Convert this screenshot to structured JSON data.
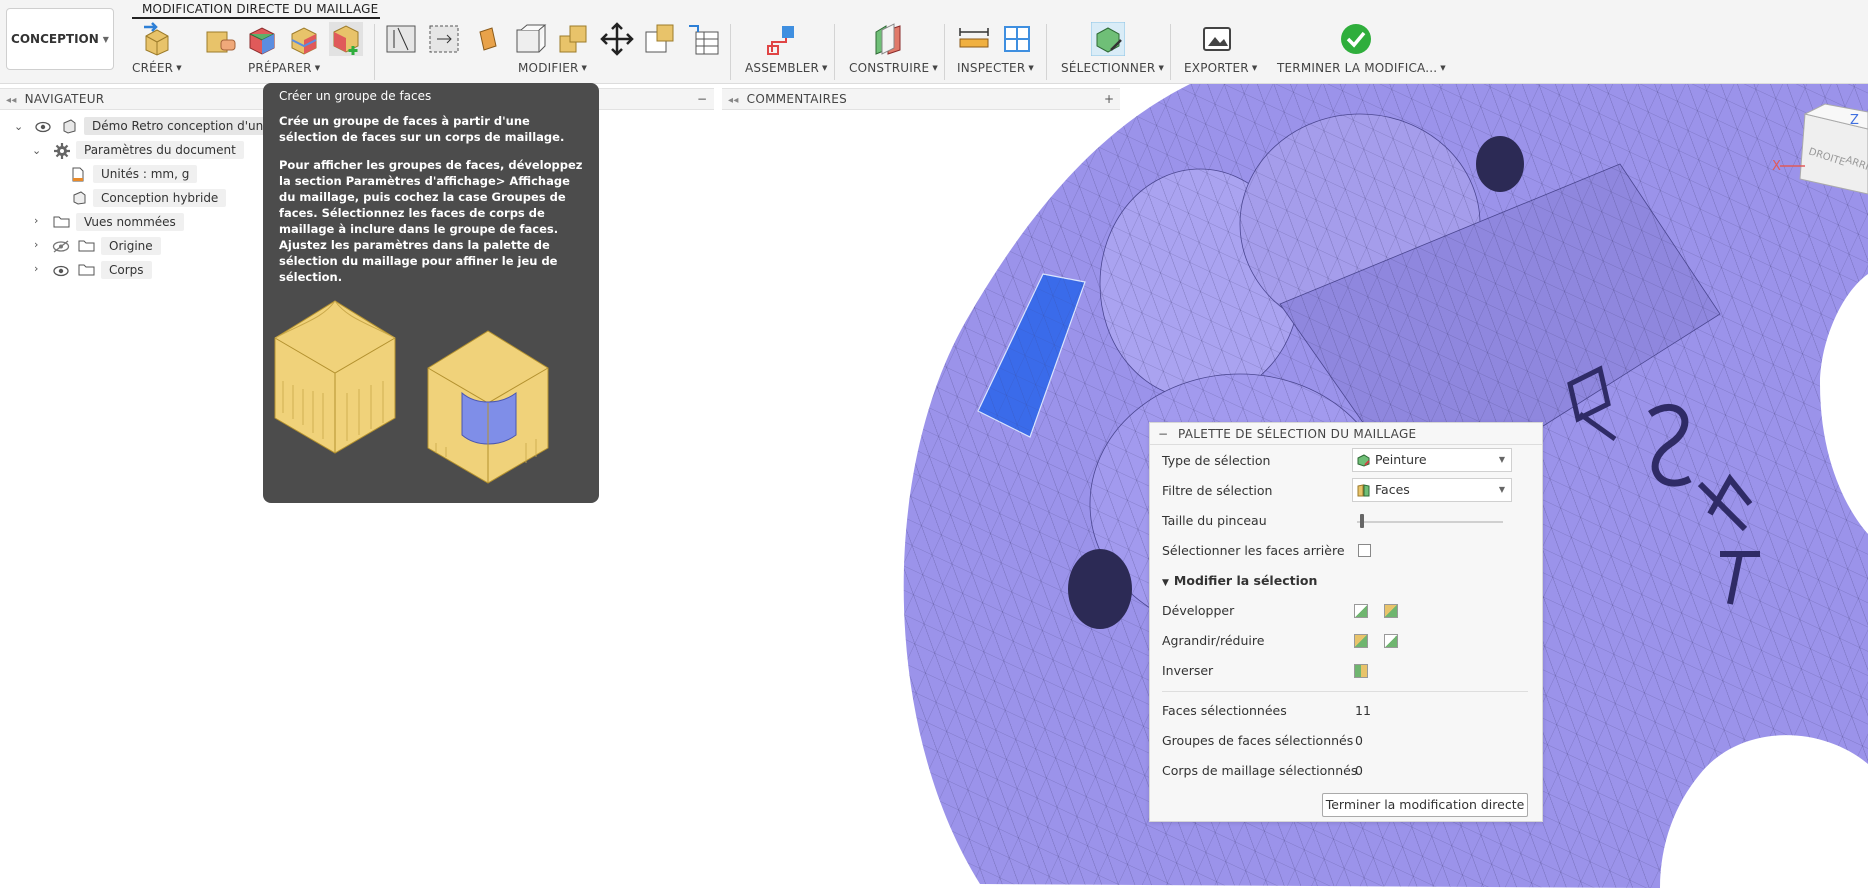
{
  "toolbar": {
    "workspace": "CONCEPTION",
    "active_tab": "MODIFICATION DIRECTE DU MAILLAGE",
    "groups": {
      "create": "CRÉER",
      "prepare": "PRÉPARER",
      "modify": "MODIFIER",
      "assemble": "ASSEMBLER",
      "construct": "CONSTRUIRE",
      "inspect": "INSPECTER",
      "select": "SÉLECTIONNER",
      "export": "EXPORTER",
      "finish": "TERMINER LA MODIFICA..."
    }
  },
  "navigator": {
    "title": "NAVIGATEUR",
    "root": "Démo Retro conception d'un S",
    "items": {
      "doc_params": "Paramètres du document",
      "units": "Unités : mm, g",
      "hybrid": "Conception hybride",
      "named_views": "Vues nommées",
      "origin": "Origine",
      "bodies": "Corps"
    }
  },
  "comments": {
    "title": "COMMENTAIRES"
  },
  "tooltip": {
    "title": "Créer un groupe de faces",
    "paragraph1": "Crée un groupe de faces à partir d'une sélection de faces sur un corps de maillage.",
    "paragraph2": "Pour afficher les groupes de faces, développez la section Paramètres d'affichage> Affichage du maillage, puis cochez la case Groupes de faces. Sélectionnez les faces de corps de maillage à inclure dans le groupe de faces. Ajustez les paramètres dans la palette de sélection du maillage pour affiner le jeu de sélection."
  },
  "palette": {
    "title": "PALETTE DE SÉLECTION DU MAILLAGE",
    "selection_type_label": "Type de sélection",
    "selection_type_value": "Peinture",
    "selection_filter_label": "Filtre de sélection",
    "selection_filter_value": "Faces",
    "brush_size_label": "Taille du pinceau",
    "brush_size": 0.02,
    "back_faces_label": "Sélectionner les faces arrière",
    "back_faces_checked": false,
    "modify_section": "Modifier la sélection",
    "develop_label": "Développer",
    "grow_shrink_label": "Agrandir/réduire",
    "invert_label": "Inverser",
    "faces_selected_label": "Faces sélectionnées",
    "faces_selected": "11",
    "face_groups_label": "Groupes de faces sélectionnés",
    "face_groups": "0",
    "mesh_bodies_label": "Corps de maillage sélectionnés",
    "mesh_bodies": "0",
    "finish_button": "Terminer la modification directe"
  },
  "viewcube": {
    "face_right": "DROITE",
    "face_back": "ARRIÈRE",
    "axis_x": "X",
    "axis_z": "Z"
  },
  "colors": {
    "mesh": "#9b93ea",
    "selection": "#3a6bea",
    "tooltip_bg": "#4c4c4c",
    "accent_green": "#2fae3c"
  }
}
